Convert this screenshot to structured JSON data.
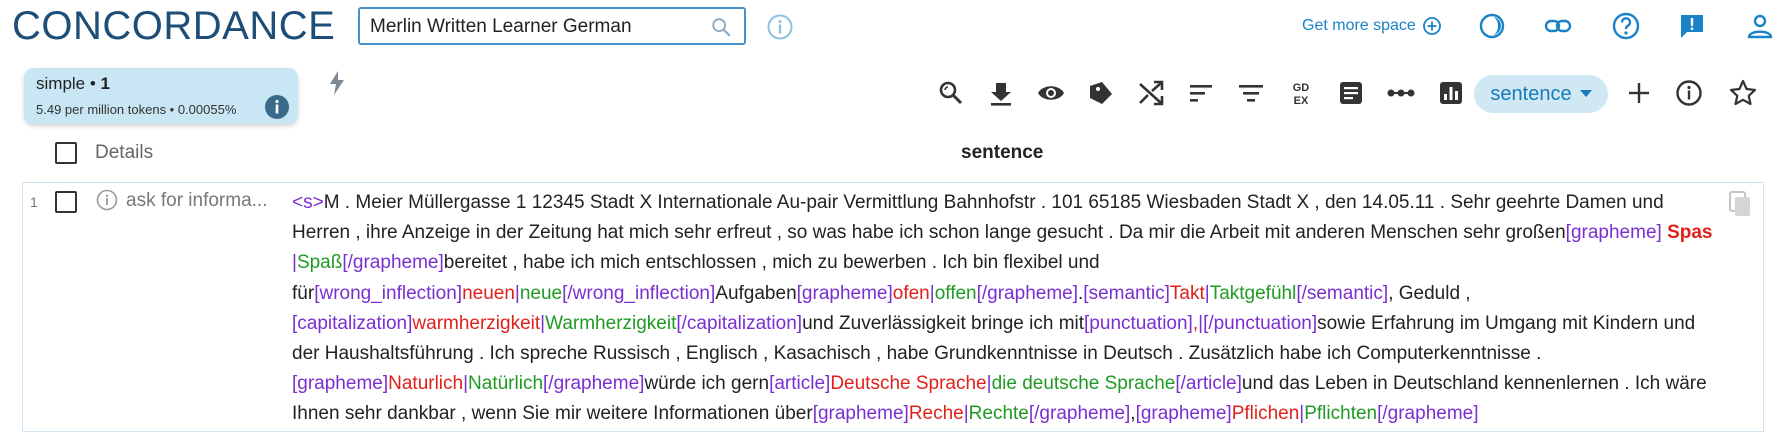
{
  "app": {
    "title": "CONCORDANCE"
  },
  "search": {
    "value": "Merlin Written Learner German",
    "placeholder": ""
  },
  "header": {
    "get_more_space": "Get more space"
  },
  "query": {
    "type": "simple",
    "count": "1",
    "frequency": "5.49 per million tokens • 0.00055%"
  },
  "toolbar": {
    "view_select": "sentence"
  },
  "table": {
    "details_label": "Details",
    "sentence_label": "sentence",
    "rows": [
      {
        "num": "1",
        "details": "ask for informa...",
        "segments": [
          {
            "t": "<s>",
            "c": "tag"
          },
          {
            "t": "M . Meier Müllergasse 1 12345 Stadt X Internationale Au-pair Vermittlung Bahnhofstr . 101 65185 Wiesbaden Stadt X , den 14.05.11 . Sehr geehrte Damen und Herren , ihre Anzeige in der Zeitung hat mich sehr erfreut , so was habe ich schon lange gesucht . Da mir die Arbeit mit anderen Menschen sehr großen",
            "c": ""
          },
          {
            "t": "[grapheme] ",
            "c": "tag"
          },
          {
            "t": "Spas ",
            "c": "err bold"
          },
          {
            "t": "|",
            "c": "tag"
          },
          {
            "t": "Spaß",
            "c": "corr"
          },
          {
            "t": "[/grapheme]",
            "c": "tag"
          },
          {
            "t": "bereitet , habe ich mich entschlossen , mich zu bewerben . Ich bin flexibel und für",
            "c": ""
          },
          {
            "t": "[wrong_inflection]",
            "c": "tag"
          },
          {
            "t": "neuen",
            "c": "err"
          },
          {
            "t": "|",
            "c": "tag"
          },
          {
            "t": "neue",
            "c": "corr"
          },
          {
            "t": "[/wrong_inflection]",
            "c": "tag"
          },
          {
            "t": "Aufgaben",
            "c": ""
          },
          {
            "t": "[grapheme]",
            "c": "tag"
          },
          {
            "t": "ofen",
            "c": "err"
          },
          {
            "t": "|",
            "c": "tag"
          },
          {
            "t": "offen",
            "c": "corr"
          },
          {
            "t": "[/grapheme]",
            "c": "tag"
          },
          {
            "t": ".",
            "c": ""
          },
          {
            "t": "[semantic]",
            "c": "tag"
          },
          {
            "t": "Takt",
            "c": "err"
          },
          {
            "t": "|",
            "c": "tag"
          },
          {
            "t": "Taktgefühl",
            "c": "corr"
          },
          {
            "t": "[/semantic]",
            "c": "tag"
          },
          {
            "t": ", Geduld , ",
            "c": ""
          },
          {
            "t": "[capitalization]",
            "c": "tag"
          },
          {
            "t": "warmherzigkeit",
            "c": "err"
          },
          {
            "t": "|",
            "c": "tag"
          },
          {
            "t": "Warmherzigkeit",
            "c": "corr"
          },
          {
            "t": "[/capitalization]",
            "c": "tag"
          },
          {
            "t": "und Zuverlässigkeit bringe ich mit",
            "c": ""
          },
          {
            "t": "[punctuation]",
            "c": "tag"
          },
          {
            "t": ",",
            "c": "err"
          },
          {
            "t": "|",
            "c": "tag"
          },
          {
            "t": "[/punctuation]",
            "c": "tag"
          },
          {
            "t": "sowie Erfahrung im Umgang mit Kindern und der Haushaltsführung . Ich spreche Russisch , Englisch , Kasachisch , habe Grundkenntnisse in Deutsch . Zusätzlich habe ich Computerkenntnisse . ",
            "c": ""
          },
          {
            "t": "[grapheme]",
            "c": "tag"
          },
          {
            "t": "Naturlich",
            "c": "err"
          },
          {
            "t": "|",
            "c": "tag"
          },
          {
            "t": "Natürlich",
            "c": "corr"
          },
          {
            "t": "[/grapheme]",
            "c": "tag"
          },
          {
            "t": "würde ich gern",
            "c": ""
          },
          {
            "t": "[article]",
            "c": "tag"
          },
          {
            "t": "Deutsche Sprache",
            "c": "err"
          },
          {
            "t": "|",
            "c": "tag"
          },
          {
            "t": "die deutsche Sprache",
            "c": "corr"
          },
          {
            "t": "[/article]",
            "c": "tag"
          },
          {
            "t": "und das Leben in Deutschland kennenlernen . Ich wäre Ihnen sehr dankbar , wenn Sie mir weitere Informationen über",
            "c": ""
          },
          {
            "t": "[grapheme]",
            "c": "tag"
          },
          {
            "t": "Reche",
            "c": "err"
          },
          {
            "t": "|",
            "c": "tag"
          },
          {
            "t": "Rechte",
            "c": "corr"
          },
          {
            "t": "[/grapheme]",
            "c": "tag"
          },
          {
            "t": ",",
            "c": ""
          },
          {
            "t": "[grapheme]",
            "c": "tag"
          },
          {
            "t": "Pflichen",
            "c": "err"
          },
          {
            "t": "|",
            "c": "tag"
          },
          {
            "t": "Pflichten",
            "c": "corr"
          },
          {
            "t": "[/grapheme]",
            "c": "tag"
          }
        ]
      }
    ]
  },
  "colors": {
    "title": "#1d4e78",
    "accent": "#1a82c6",
    "tag": "#7a2fd0",
    "error": "#e0201a",
    "correction": "#1f9a23",
    "query_box": "#c8e6f3"
  },
  "icons": {
    "search": "search-icon",
    "info": "info-icon",
    "add-circle": "add-circle-icon",
    "theme": "theme-icon",
    "link": "link-icon",
    "help": "help-icon",
    "feedback": "feedback-icon",
    "user": "user-icon",
    "flash": "flash-icon",
    "toolbar": [
      "zoom-icon",
      "download-icon",
      "view-icon",
      "label-icon",
      "shuffle-icon",
      "sort-icon",
      "filter-icon",
      "gdex-icon",
      "text-type-icon",
      "collocation-icon",
      "frequency-icon",
      "add-icon",
      "info-icon",
      "star-icon"
    ],
    "copy": "copy-icon"
  }
}
